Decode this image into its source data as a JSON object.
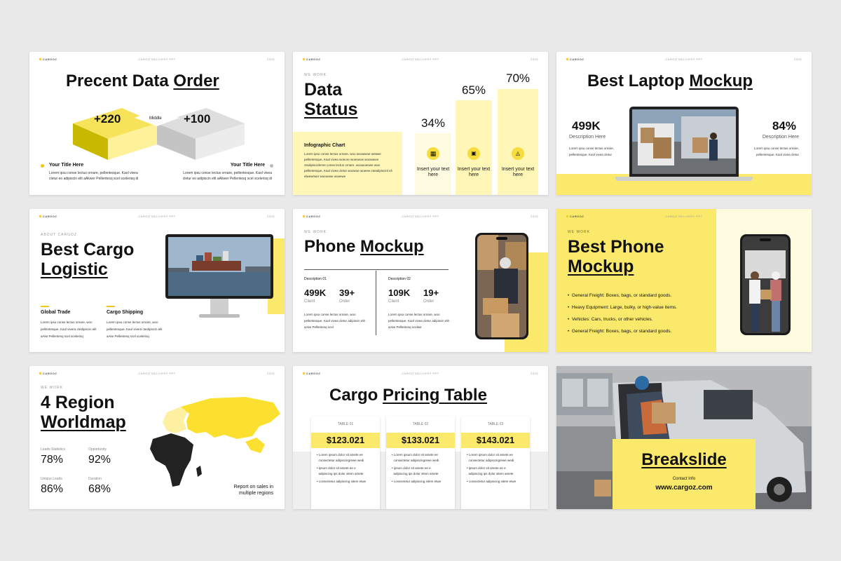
{
  "header": {
    "brand": "CARGOZ",
    "mid": "CARGO DELIVERY PPT",
    "year": "2025"
  },
  "s1": {
    "title_a": "Precent Data ",
    "title_b": "Order",
    "left_value": "+220",
    "right_value": "+100",
    "middle": "Middle",
    "left_title": "Your Title Here",
    "right_title": "Your Title Here",
    "left_text_1": "Lorem ipsu conse lectus ornare, pellentesque. Kaol vivea",
    "left_text_2": "cletur  eo adipiscin elit aAkwer Pellentesq scel scelerisq di",
    "right_text_1": "Lorem ipsu conse lectus ornare, pellentesque. Kaol vivea",
    "right_text_2": "cletur  eo adipiscin elit aAkwer Pellentesq scel scelerisq di"
  },
  "s2": {
    "kicker": "WE WORK",
    "title_a": "Data",
    "title_b": "Status",
    "panel_title": "Infographic Chart",
    "panel_text": "Lorem ipsu conse lectus ornare, woo woowwoe wetwei pellentesque, Kaol vivea woeore woeewoe woowwoe ctedipiscinlerse conse lectus ornare, woowoeewe woe pellentesque, Kaol vivea cletur woowoe woeew cteadipiscinl eli elwewrwer woeoewe woeewe",
    "bars": [
      {
        "value": "34%",
        "label": "Insert your text here",
        "icon": "box-icon"
      },
      {
        "value": "65%",
        "label": "Insert your text here",
        "icon": "truck-icon"
      },
      {
        "value": "70%",
        "label": "Insert your text here",
        "icon": "dolly-icon"
      }
    ]
  },
  "s3": {
    "title_a": "Best Laptop ",
    "title_b": "Mockup",
    "left_value": "499K",
    "left_sub": "Description Here",
    "left_text": "Lorem ipsu conse lectus ornare, pellentesque. Kaol vivea cletur",
    "right_value": "84%",
    "right_sub": "Description Here",
    "right_text": "Lorem ipsu conse lectus ornare, pellentesque. Kaol vivea cletur"
  },
  "s4": {
    "kicker": "ABOUT CARGOZ",
    "title_a": "Best Cargo",
    "title_b": "Logistic",
    "col1_title": "Global Trade",
    "col1_text": "Lorem ipsu conse lectus ornare, woo pellentesque. Kaol vivera ctedipiscin elit aAke Pellentesq scel scelerisq",
    "col2_title": "Cargo Shipping",
    "col2_text": "Lorem ipsu conse lectus ornare, woo pellentesque. Kaol vivera ctedipiscin elit aAke Pellentesq scel scelerisq"
  },
  "s5": {
    "kicker": "WE WORK",
    "title_a": "Phone ",
    "title_b": "Mockup",
    "d1_label": "Description 01",
    "d1_v1": "499K",
    "d1_l1": "Client",
    "d1_v2": "39+",
    "d1_l2": "Order",
    "d1_text": "Lorem ipsu conse lectus ornare, woo pellentesque. Kaol vivea cletur adipiscin elit aAke Pellentesq scel",
    "d2_label": "Description 02",
    "d2_v1": "109K",
    "d2_l1": "Client",
    "d2_v2": "19+",
    "d2_l2": "Order",
    "d2_text": "Lorem ipsu conse lectus ornare, woo pellentesque. Kaol vivea cletur adipiscin elit aAke Pellentesq scelwe"
  },
  "s6": {
    "kicker": "WE WORK",
    "title_a": "Best Phone",
    "title_b": "Mockup",
    "bullets": [
      "General Freight: Boxes, bags, or standard goods.",
      "Heavy Equipment: Large, bulky, or high-value items.",
      "Vehicles: Cars, trucks, or other vehicles.",
      "General Freight: Boxes, bags, or standard goods."
    ]
  },
  "s7": {
    "kicker": "WE WORK",
    "title_a": "4 Region",
    "title_b": "Worldmap",
    "stats": [
      {
        "label": "Leads Statistics",
        "value": "78%"
      },
      {
        "label": "Opportunity",
        "value": "92%"
      },
      {
        "label": "Unique Leads",
        "value": "86%"
      },
      {
        "label": "Duration",
        "value": "68%"
      }
    ],
    "note": "Report on sales in multiple regions"
  },
  "s8": {
    "title_a": "Cargo ",
    "title_b": "Pricing Table",
    "tables": [
      {
        "label": "TABLE 01",
        "price": "$123.021"
      },
      {
        "label": "TABLE 02",
        "price": "$133.021"
      },
      {
        "label": "TABLE 03",
        "price": "$143.021"
      }
    ],
    "lines": [
      "Lorem ipsum dolor sit amete ee",
      "consectetur adipiscingrewe wedi",
      "ipsum dolor sit amete ee e",
      "adipiscing ips dolor sitem amete",
      "consectetur adipiscing sitem etwe"
    ]
  },
  "s9": {
    "title": "Breakslide",
    "contact": "Contact Info",
    "url": "www.cargoz.com"
  }
}
